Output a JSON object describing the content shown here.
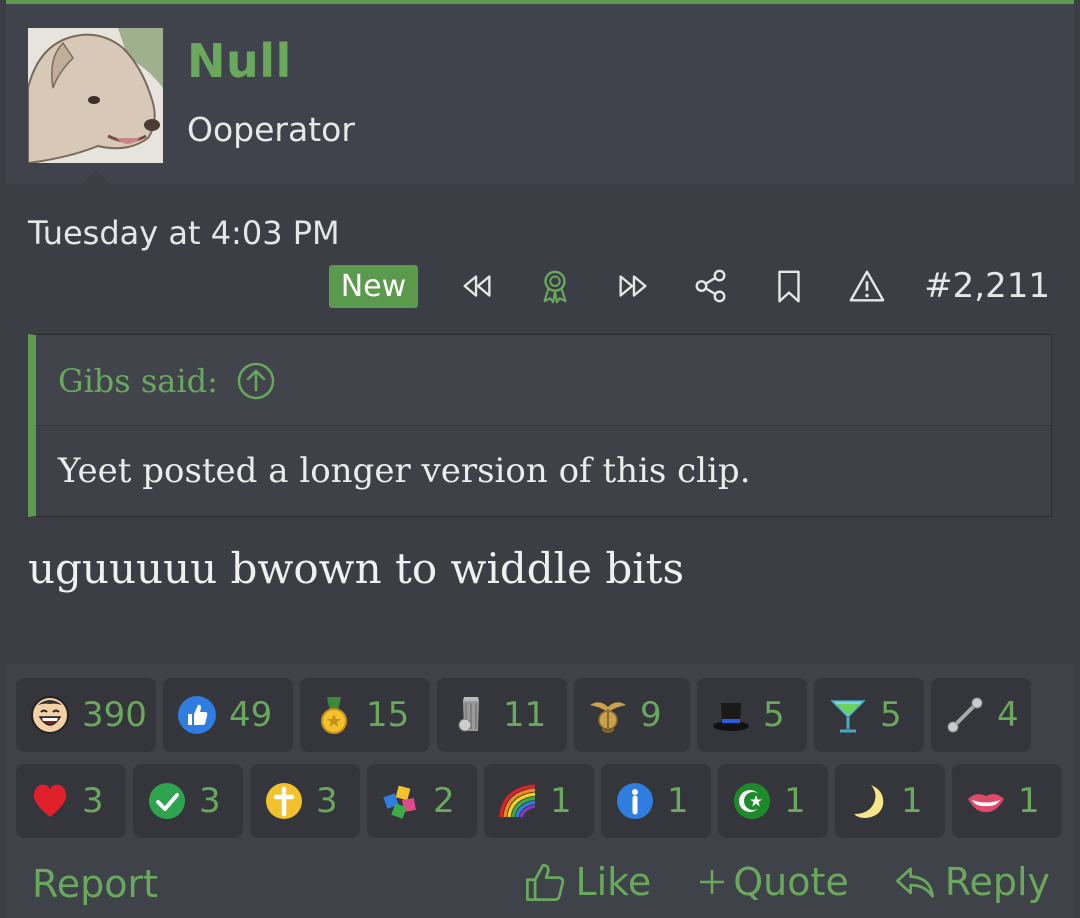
{
  "user": {
    "name": "Null",
    "title": "Ooperator"
  },
  "post": {
    "date": "Tuesday at 4:03 PM",
    "badge": "New",
    "number": "#2,211",
    "quote": {
      "author": "Gibs said:",
      "text": "Yeet posted a longer version of this clip."
    },
    "message": "uguuuuu bwown to widdle bits"
  },
  "reactions_row1": [
    {
      "icon": "laughing-face-icon",
      "count": "390"
    },
    {
      "icon": "thumbs-up-icon",
      "count": "49"
    },
    {
      "icon": "gold-medal-icon",
      "count": "15"
    },
    {
      "icon": "trash-can-icon",
      "count": "11"
    },
    {
      "icon": "eagle-globe-anchor-icon",
      "count": "9"
    },
    {
      "icon": "top-hat-icon",
      "count": "5"
    },
    {
      "icon": "cocktail-glass-icon",
      "count": "5"
    },
    {
      "icon": "barbell-icon",
      "count": "4"
    }
  ],
  "reactions_row2": [
    {
      "icon": "heart-icon",
      "count": "3"
    },
    {
      "icon": "check-mark-icon",
      "count": "3"
    },
    {
      "icon": "cross-icon",
      "count": "3"
    },
    {
      "icon": "puzzle-pieces-icon",
      "count": "2"
    },
    {
      "icon": "rainbow-icon",
      "count": "1"
    },
    {
      "icon": "info-icon",
      "count": "1"
    },
    {
      "icon": "star-crescent-icon",
      "count": "1"
    },
    {
      "icon": "crescent-moon-icon",
      "count": "1"
    },
    {
      "icon": "lips-icon",
      "count": "1"
    }
  ],
  "footer": {
    "report": "Report",
    "like": "Like",
    "quote": "Quote",
    "reply": "Reply"
  },
  "colors": {
    "accent": "#6aa85d",
    "background": "#3b3e45",
    "badge": "#5b9a4d"
  }
}
